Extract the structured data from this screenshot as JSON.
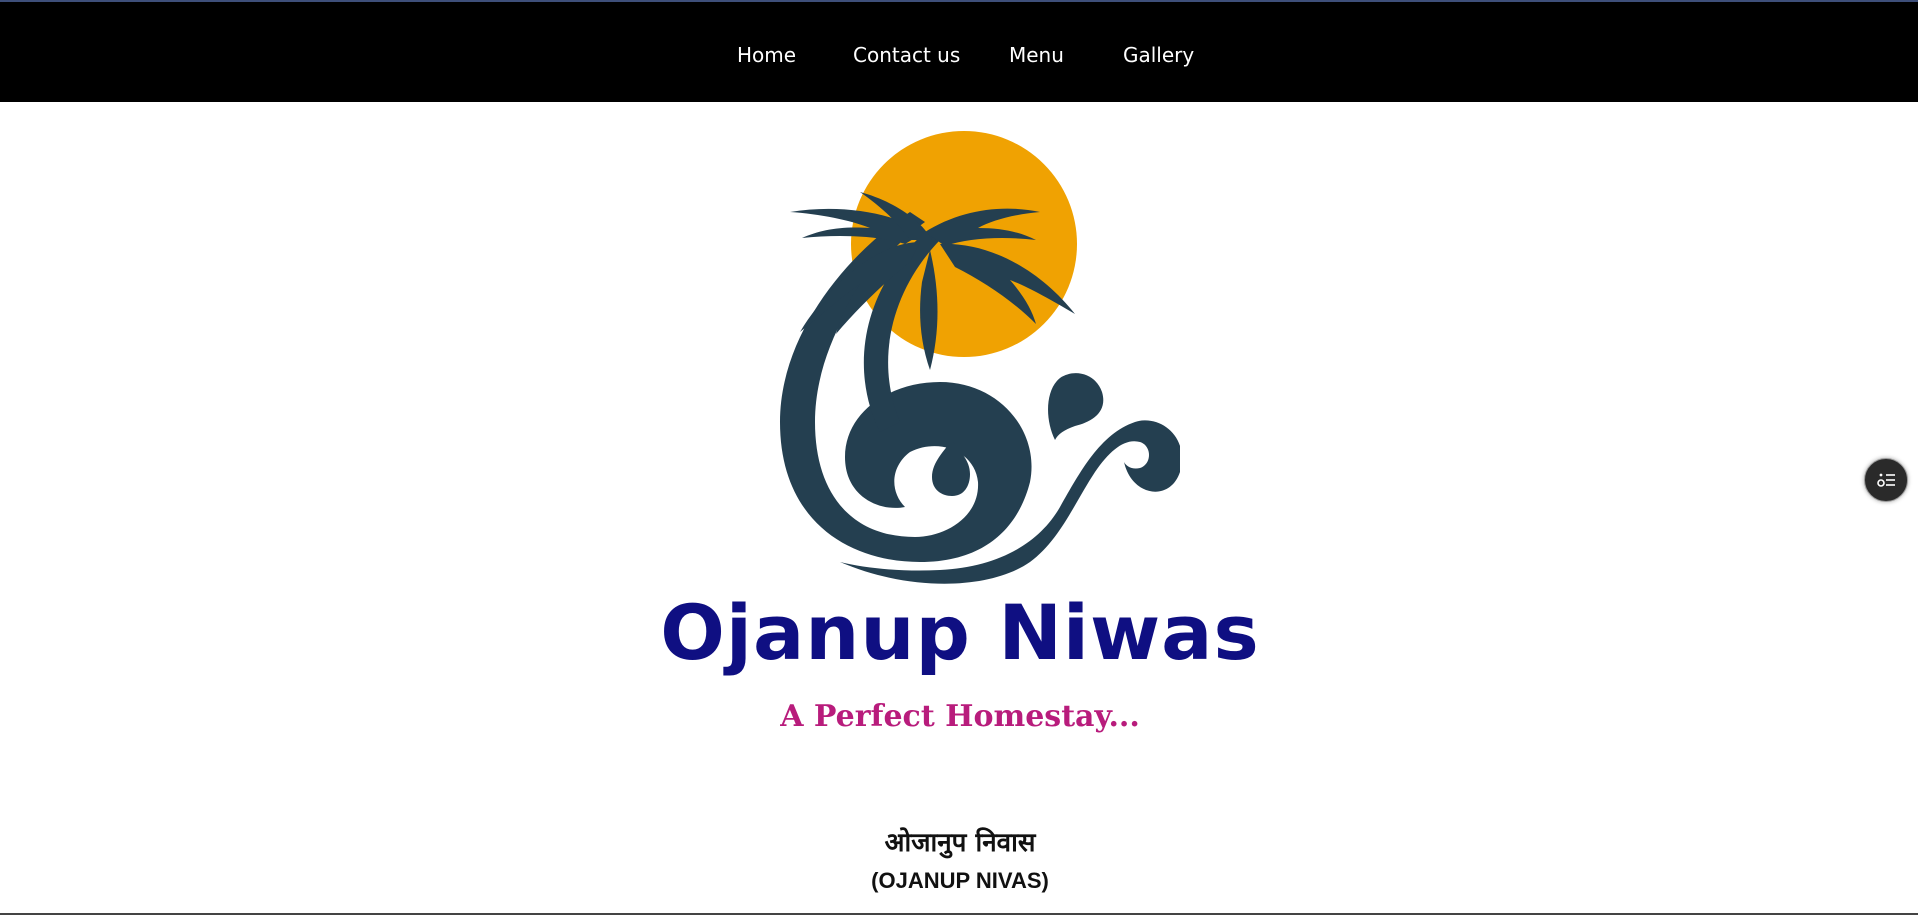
{
  "nav": {
    "items": [
      {
        "label": "Home"
      },
      {
        "label": "Contact us"
      },
      {
        "label": "Menu"
      },
      {
        "label": "Gallery"
      }
    ]
  },
  "brand": {
    "name": "Ojanup Niwas",
    "tagline": "A Perfect Homestay...",
    "logo_icon": "palm-tree-sun-wave-logo"
  },
  "content": {
    "heading_hindi": "ओजानुप निवास",
    "heading_english": "(OJANUP NIVAS)"
  },
  "floating_button": {
    "icon": "settings-list-icon"
  },
  "colors": {
    "nav_background": "#000000",
    "nav_text": "#ffffff",
    "brand_name": "#0f0f82",
    "tagline": "#b81c7c",
    "sun": "#f0a202",
    "logo_dark": "#243f50"
  }
}
